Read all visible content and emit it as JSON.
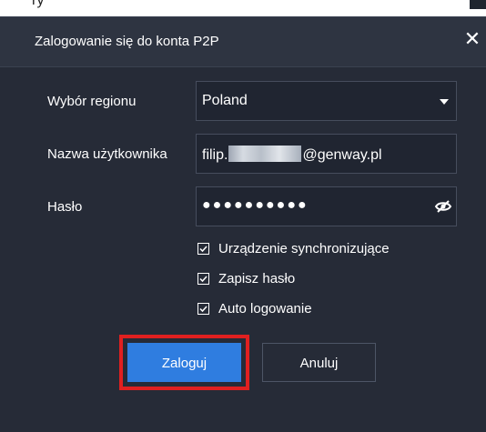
{
  "top_fragment": {
    "text": "ry"
  },
  "dialog": {
    "title": "Zalogowanie się do konta P2P",
    "close_glyph": "✕"
  },
  "form": {
    "region_label": "Wybór regionu",
    "region_value": "Poland",
    "username_label": "Nazwa użytkownika",
    "username_prefix": "filip.",
    "username_suffix": "@genway.pl",
    "password_label": "Hasło",
    "password_masked": "●●●●●●●●●●",
    "password_toggle_icon": "eye-slash-icon"
  },
  "options": [
    {
      "label": "Urządzenie synchronizujące",
      "checked": true
    },
    {
      "label": "Zapisz hasło",
      "checked": true
    },
    {
      "label": "Auto logowanie",
      "checked": true
    }
  ],
  "buttons": {
    "login_label": "Zaloguj",
    "cancel_label": "Anuluj"
  },
  "colors": {
    "dialog_bg": "#262b37",
    "titlebar_bg": "#2e3441",
    "primary_button": "#2f7de0",
    "highlight_border": "#e02020"
  }
}
